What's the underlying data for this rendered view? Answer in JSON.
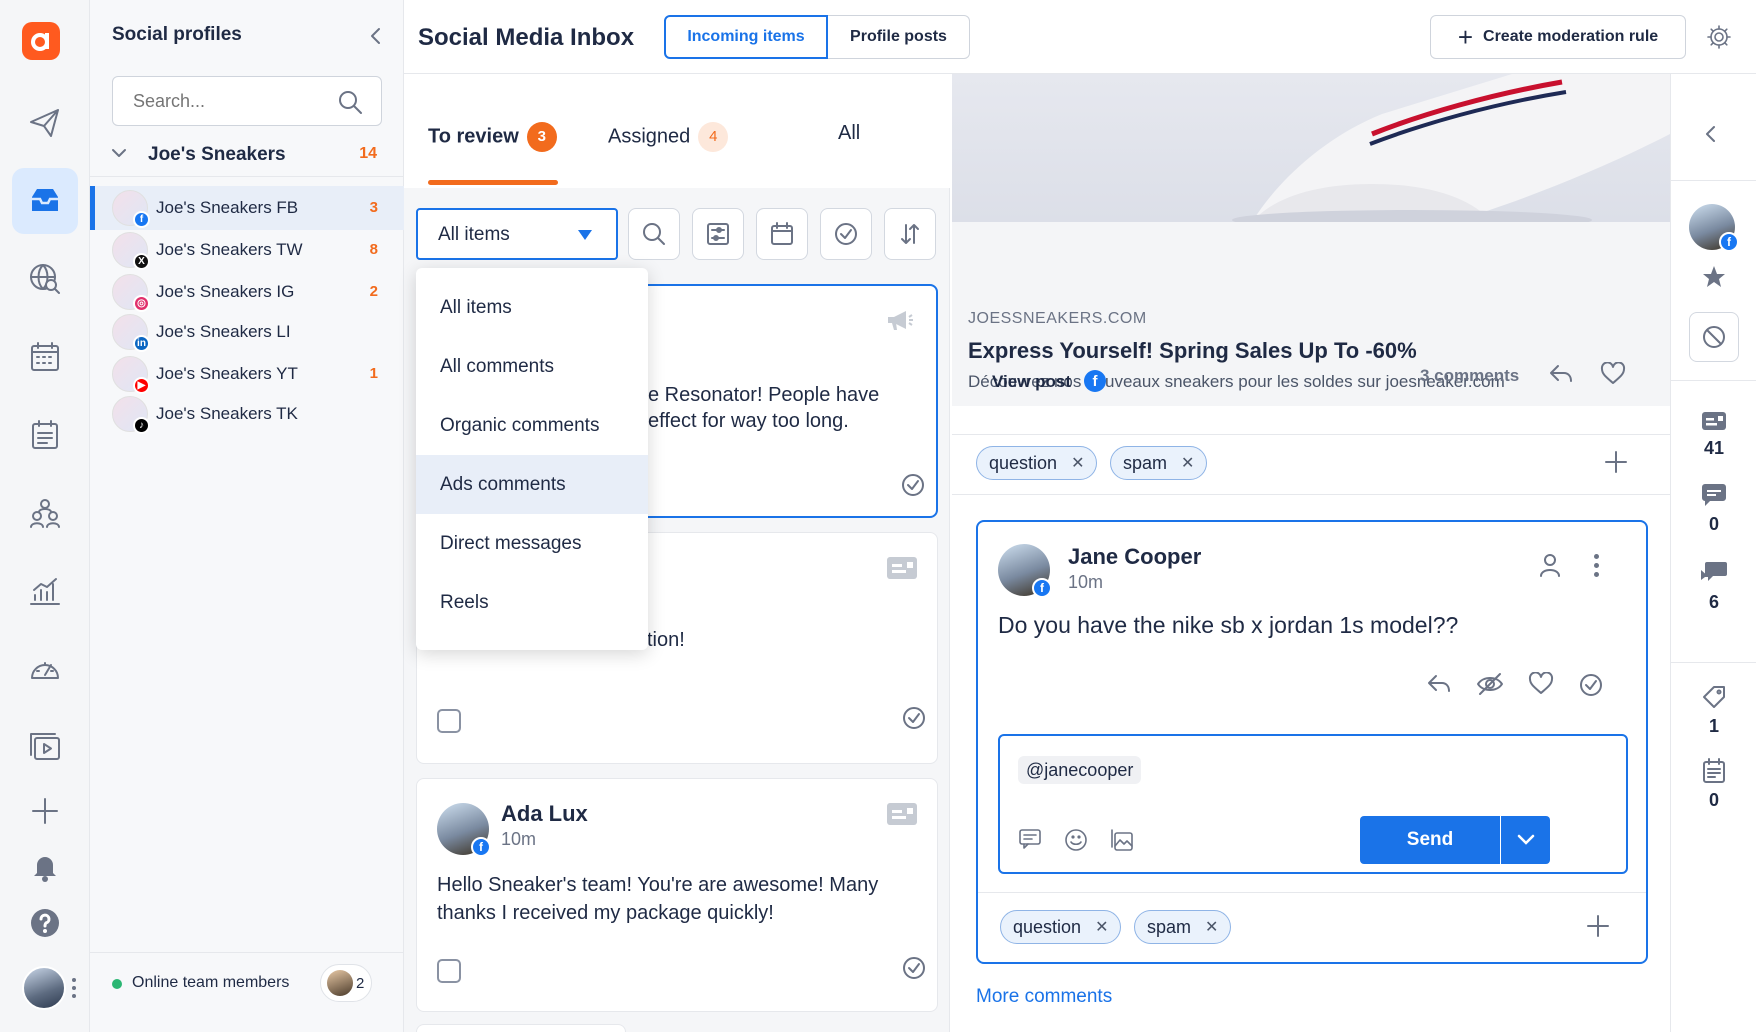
{
  "sidebar": {
    "title": "Social profiles",
    "search_placeholder": "Search...",
    "group": {
      "name": "Joe's Sneakers",
      "count": "14"
    },
    "profiles": [
      {
        "name": "Joe's Sneakers FB",
        "count": "3",
        "network": "facebook",
        "color": "#1877f2",
        "glyph": "f"
      },
      {
        "name": "Joe's Sneakers TW",
        "count": "8",
        "network": "x",
        "color": "#111111",
        "glyph": "X"
      },
      {
        "name": "Joe's Sneakers IG",
        "count": "2",
        "network": "instagram",
        "color": "#e1306c",
        "glyph": "◎"
      },
      {
        "name": "Joe's Sneakers LI",
        "count": "",
        "network": "linkedin",
        "color": "#0a66c2",
        "glyph": "in"
      },
      {
        "name": "Joe's Sneakers YT",
        "count": "1",
        "network": "youtube",
        "color": "#ff0000",
        "glyph": "▶"
      },
      {
        "name": "Joe's Sneakers TK",
        "count": "",
        "network": "tiktok",
        "color": "#000000",
        "glyph": "♪"
      }
    ],
    "online_label": "Online team members",
    "online_count": "2"
  },
  "header": {
    "title": "Social Media Inbox",
    "tab_incoming": "Incoming items",
    "tab_profile_posts": "Profile posts",
    "create_rule": "Create moderation rule"
  },
  "list": {
    "tabs": {
      "review": "To review",
      "review_count": "3",
      "assigned": "Assigned",
      "assigned_count": "4",
      "all": "All"
    },
    "filter_value": "All items",
    "dropdown": [
      "All items",
      "All comments",
      "Organic comments",
      "Ads comments",
      "Direct messages",
      "Reels"
    ],
    "card1": {
      "line1": "e Resonator! People have",
      "line2": "effect for way too long."
    },
    "card2": {
      "text": "tion!"
    },
    "card3": {
      "author": "Ada Lux",
      "time": "10m",
      "line1": "Hello Sneaker's team! You're are awesome! Many",
      "line2": "thanks I received my package quickly!"
    }
  },
  "post": {
    "domain": "JOESSNEAKERS.COM",
    "headline": "Express Yourself! Spring Sales Up To -60%",
    "description": "Découvrez nos nouveaux sneakers pour les soldes sur joesneaker.com",
    "view_post": "View post",
    "comments": "3 comments",
    "tags": [
      "question",
      "spam"
    ],
    "comment": {
      "author": "Jane Cooper",
      "time": "10m",
      "text": "Do you have the nike sb x jordan 1s model??"
    },
    "reply_mention": "@janecooper",
    "send": "Send",
    "reply_tags": [
      "question",
      "spam"
    ],
    "more_comments": "More comments"
  },
  "rail": {
    "count_messages": "41",
    "count_comments": "0",
    "count_chat": "6",
    "count_tags": "1",
    "count_notes": "0"
  },
  "colors": {
    "accent": "#1a73e8",
    "orange": "#f26b1d",
    "brand": "#ff5a1f"
  }
}
